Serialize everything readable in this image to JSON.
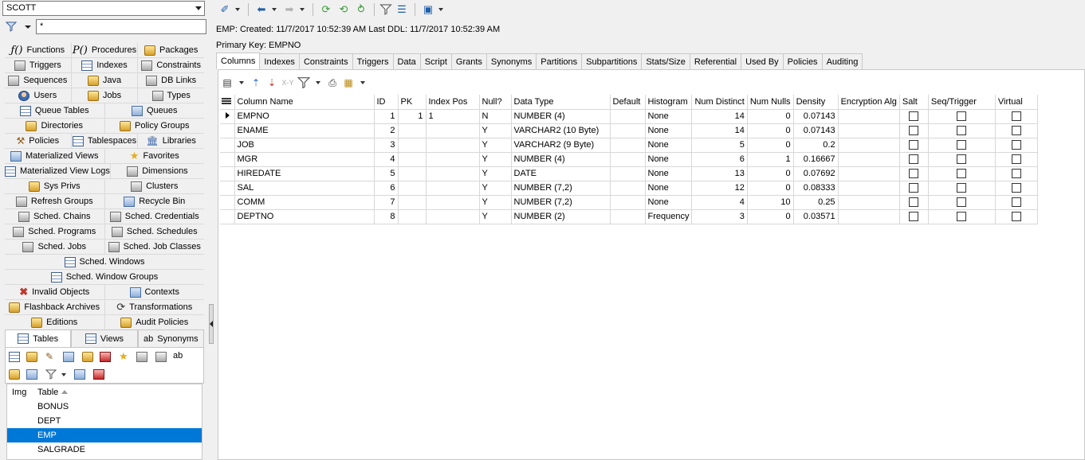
{
  "schema": {
    "selected": "SCOTT"
  },
  "filter": {
    "value": "*"
  },
  "object_types": [
    [
      {
        "label": "Functions",
        "icon": "function-icon"
      },
      {
        "label": "Procedures",
        "icon": "procedure-icon"
      },
      {
        "label": "Packages",
        "icon": "package-icon"
      }
    ],
    [
      {
        "label": "Triggers",
        "icon": "trigger-icon"
      },
      {
        "label": "Indexes",
        "icon": "index-icon"
      },
      {
        "label": "Constraints",
        "icon": "constraint-icon"
      }
    ],
    [
      {
        "label": "Sequences",
        "icon": "sequence-icon"
      },
      {
        "label": "Java",
        "icon": "java-icon"
      },
      {
        "label": "DB Links",
        "icon": "db-link-icon"
      }
    ],
    [
      {
        "label": "Users",
        "icon": "users-icon"
      },
      {
        "label": "Jobs",
        "icon": "jobs-icon"
      },
      {
        "label": "Types",
        "icon": "types-icon"
      }
    ],
    [
      {
        "label": "Queue Tables",
        "icon": "queue-table-icon"
      },
      {
        "label": "Queues",
        "icon": "queue-icon"
      }
    ],
    [
      {
        "label": "Directories",
        "icon": "directory-icon"
      },
      {
        "label": "Policy Groups",
        "icon": "policy-group-icon"
      }
    ],
    [
      {
        "label": "Policies",
        "icon": "policy-icon"
      },
      {
        "label": "Tablespaces",
        "icon": "tablespace-icon"
      },
      {
        "label": "Libraries",
        "icon": "library-icon"
      }
    ],
    [
      {
        "label": "Materialized Views",
        "icon": "materialized-view-icon"
      },
      {
        "label": "Favorites",
        "icon": "star-icon"
      }
    ],
    [
      {
        "label": "Materialized View Logs",
        "icon": "mview-log-icon"
      },
      {
        "label": "Dimensions",
        "icon": "dimension-icon"
      }
    ],
    [
      {
        "label": "Sys Privs",
        "icon": "sys-privs-icon"
      },
      {
        "label": "Clusters",
        "icon": "cluster-icon"
      }
    ],
    [
      {
        "label": "Refresh Groups",
        "icon": "refresh-group-icon"
      },
      {
        "label": "Recycle Bin",
        "icon": "recycle-bin-icon"
      }
    ],
    [
      {
        "label": "Sched. Chains",
        "icon": "sched-chain-icon"
      },
      {
        "label": "Sched. Credentials",
        "icon": "sched-credential-icon"
      }
    ],
    [
      {
        "label": "Sched. Programs",
        "icon": "sched-program-icon"
      },
      {
        "label": "Sched. Schedules",
        "icon": "sched-schedule-icon"
      }
    ],
    [
      {
        "label": "Sched. Jobs",
        "icon": "sched-job-icon"
      },
      {
        "label": "Sched. Job Classes",
        "icon": "sched-job-class-icon"
      }
    ],
    [
      {
        "label": "Sched. Windows",
        "icon": "sched-window-icon"
      }
    ],
    [
      {
        "label": "Sched. Window Groups",
        "icon": "sched-window-group-icon"
      }
    ],
    [
      {
        "label": "Invalid Objects",
        "icon": "invalid-objects-icon"
      },
      {
        "label": "Contexts",
        "icon": "context-icon"
      }
    ],
    [
      {
        "label": "Flashback Archives",
        "icon": "flashback-archive-icon"
      },
      {
        "label": "Transformations",
        "icon": "transformation-icon"
      }
    ],
    [
      {
        "label": "Editions",
        "icon": "edition-icon"
      },
      {
        "label": "Audit Policies",
        "icon": "audit-policy-icon"
      }
    ]
  ],
  "lower_tabs": [
    {
      "label": "Tables",
      "icon": "table-icon"
    },
    {
      "label": "Views",
      "icon": "view-icon"
    },
    {
      "label": "Synonyms",
      "icon": "synonym-icon"
    }
  ],
  "tables_list": {
    "headers": [
      "Img",
      "Table"
    ],
    "rows": [
      "BONUS",
      "DEPT",
      "EMP",
      "SALGRADE"
    ],
    "selected": "EMP"
  },
  "object_info": {
    "line1": "EMP:  Created: 11/7/2017 10:52:39 AM   Last DDL: 11/7/2017 10:52:39 AM",
    "line2": "Primary Key:  EMPNO"
  },
  "detail_tabs": [
    "Columns",
    "Indexes",
    "Constraints",
    "Triggers",
    "Data",
    "Script",
    "Grants",
    "Synonyms",
    "Partitions",
    "Subpartitions",
    "Stats/Size",
    "Referential",
    "Used By",
    "Policies",
    "Auditing"
  ],
  "active_tab": "Columns",
  "columns_grid": {
    "headers": [
      "Column Name",
      "ID",
      "PK",
      "Index Pos",
      "Null?",
      "Data Type",
      "Default",
      "Histogram",
      "Num Distinct",
      "Num Nulls",
      "Density",
      "Encryption Alg",
      "Salt",
      "Seq/Trigger",
      "Virtual"
    ],
    "rows": [
      {
        "name": "EMPNO",
        "id": "1",
        "pk": "1",
        "index_pos": "1",
        "null": "N",
        "data_type": "NUMBER (4)",
        "default": "",
        "histogram": "None",
        "num_distinct": "14",
        "num_nulls": "0",
        "density": "0.07143",
        "enc": "",
        "salt": false,
        "seq": false,
        "virtual": false
      },
      {
        "name": "ENAME",
        "id": "2",
        "pk": "",
        "index_pos": "",
        "null": "Y",
        "data_type": "VARCHAR2 (10 Byte)",
        "default": "",
        "histogram": "None",
        "num_distinct": "14",
        "num_nulls": "0",
        "density": "0.07143",
        "enc": "",
        "salt": false,
        "seq": false,
        "virtual": false
      },
      {
        "name": "JOB",
        "id": "3",
        "pk": "",
        "index_pos": "",
        "null": "Y",
        "data_type": "VARCHAR2 (9 Byte)",
        "default": "",
        "histogram": "None",
        "num_distinct": "5",
        "num_nulls": "0",
        "density": "0.2",
        "enc": "",
        "salt": false,
        "seq": false,
        "virtual": false
      },
      {
        "name": "MGR",
        "id": "4",
        "pk": "",
        "index_pos": "",
        "null": "Y",
        "data_type": "NUMBER (4)",
        "default": "",
        "histogram": "None",
        "num_distinct": "6",
        "num_nulls": "1",
        "density": "0.16667",
        "enc": "",
        "salt": false,
        "seq": false,
        "virtual": false
      },
      {
        "name": "HIREDATE",
        "id": "5",
        "pk": "",
        "index_pos": "",
        "null": "Y",
        "data_type": "DATE",
        "default": "",
        "histogram": "None",
        "num_distinct": "13",
        "num_nulls": "0",
        "density": "0.07692",
        "enc": "",
        "salt": false,
        "seq": false,
        "virtual": false
      },
      {
        "name": "SAL",
        "id": "6",
        "pk": "",
        "index_pos": "",
        "null": "Y",
        "data_type": "NUMBER (7,2)",
        "default": "",
        "histogram": "None",
        "num_distinct": "12",
        "num_nulls": "0",
        "density": "0.08333",
        "enc": "",
        "salt": false,
        "seq": false,
        "virtual": false
      },
      {
        "name": "COMM",
        "id": "7",
        "pk": "",
        "index_pos": "",
        "null": "Y",
        "data_type": "NUMBER (7,2)",
        "default": "",
        "histogram": "None",
        "num_distinct": "4",
        "num_nulls": "10",
        "density": "0.25",
        "enc": "",
        "salt": false,
        "seq": false,
        "virtual": false
      },
      {
        "name": "DEPTNO",
        "id": "8",
        "pk": "",
        "index_pos": "",
        "null": "Y",
        "data_type": "NUMBER (2)",
        "default": "",
        "histogram": "Frequency",
        "num_distinct": "3",
        "num_nulls": "0",
        "density": "0.03571",
        "enc": "",
        "salt": false,
        "seq": false,
        "virtual": false
      }
    ]
  },
  "colors": {
    "selection": "#0078d7",
    "panel_bg": "#f0f0f0"
  }
}
